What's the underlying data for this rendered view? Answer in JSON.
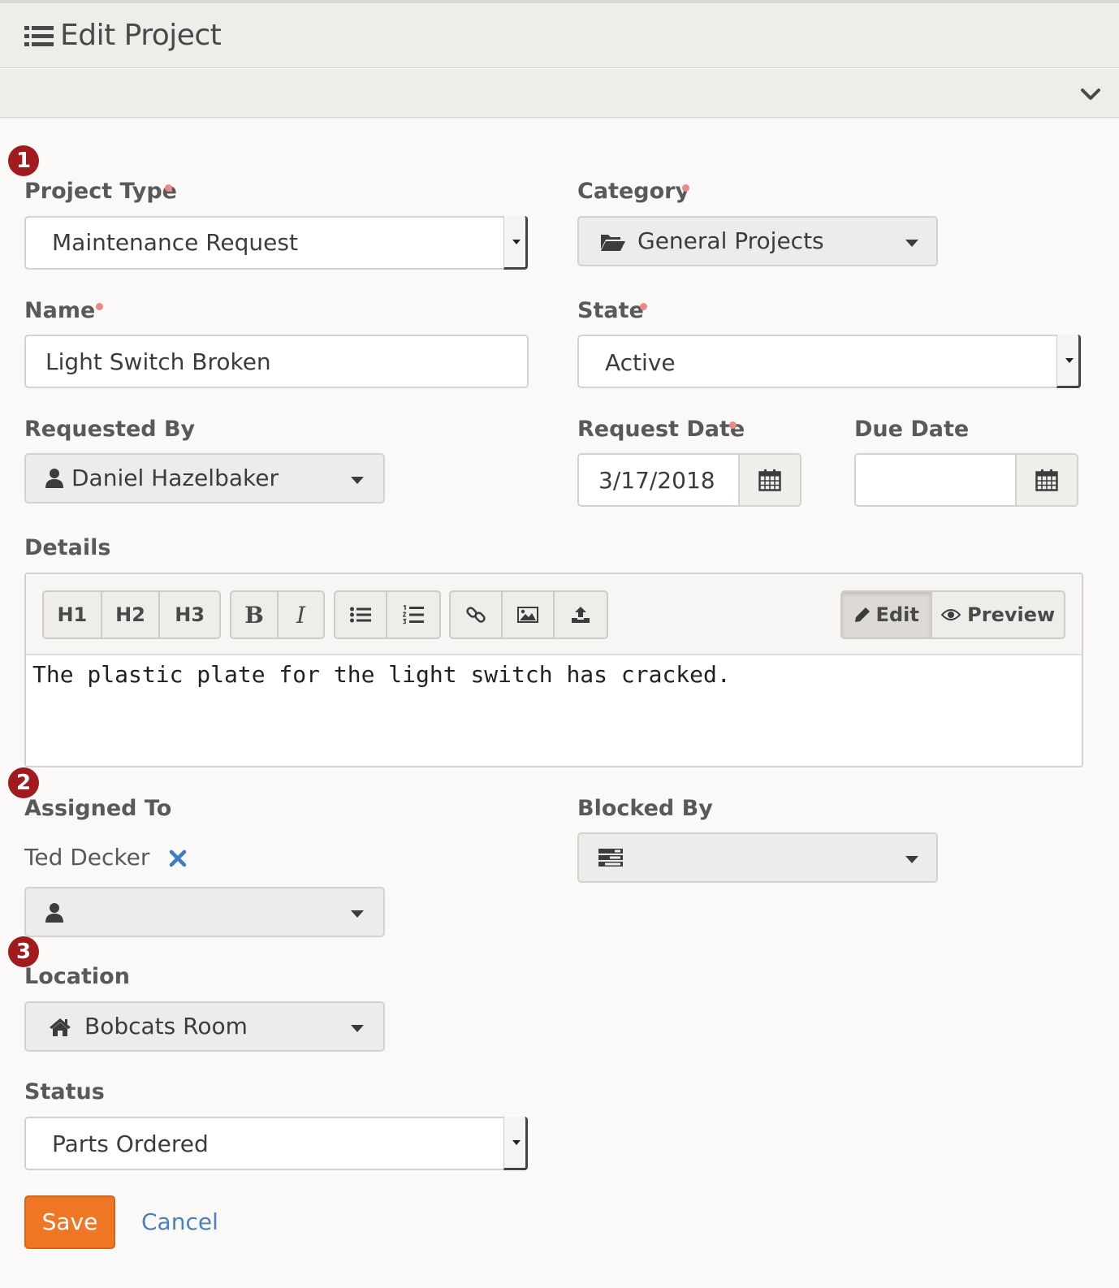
{
  "header": {
    "title": "Edit Project"
  },
  "steps": [
    "1",
    "2",
    "3"
  ],
  "fields": {
    "project_type": {
      "label": "Project Type",
      "value": "Maintenance Request"
    },
    "category": {
      "label": "Category",
      "value": "General Projects"
    },
    "name": {
      "label": "Name",
      "value": "Light Switch Broken"
    },
    "state": {
      "label": "State",
      "value": "Active"
    },
    "requested_by": {
      "label": "Requested By",
      "value": "Daniel Hazelbaker"
    },
    "request_date": {
      "label": "Request Date",
      "value": "3/17/2018"
    },
    "due_date": {
      "label": "Due Date",
      "value": ""
    },
    "details": {
      "label": "Details",
      "value": "The plastic plate for the light switch has cracked."
    },
    "assigned_to": {
      "label": "Assigned To",
      "assignee": "Ted Decker",
      "picker_value": ""
    },
    "blocked_by": {
      "label": "Blocked By",
      "value": ""
    },
    "location": {
      "label": "Location",
      "value": "Bobcats Room"
    },
    "status": {
      "label": "Status",
      "value": "Parts Ordered"
    }
  },
  "editor_toolbar": {
    "headings": [
      "H1",
      "H2",
      "H3"
    ],
    "bold": "B",
    "italic": "I",
    "edit_label": "Edit",
    "preview_label": "Preview"
  },
  "actions": {
    "save": "Save",
    "cancel": "Cancel"
  },
  "colors": {
    "primary": "#ee7625",
    "link": "#4a81bc",
    "badge": "#a01a1e",
    "required": "#e88a8a",
    "remove": "#3b7dc4"
  }
}
